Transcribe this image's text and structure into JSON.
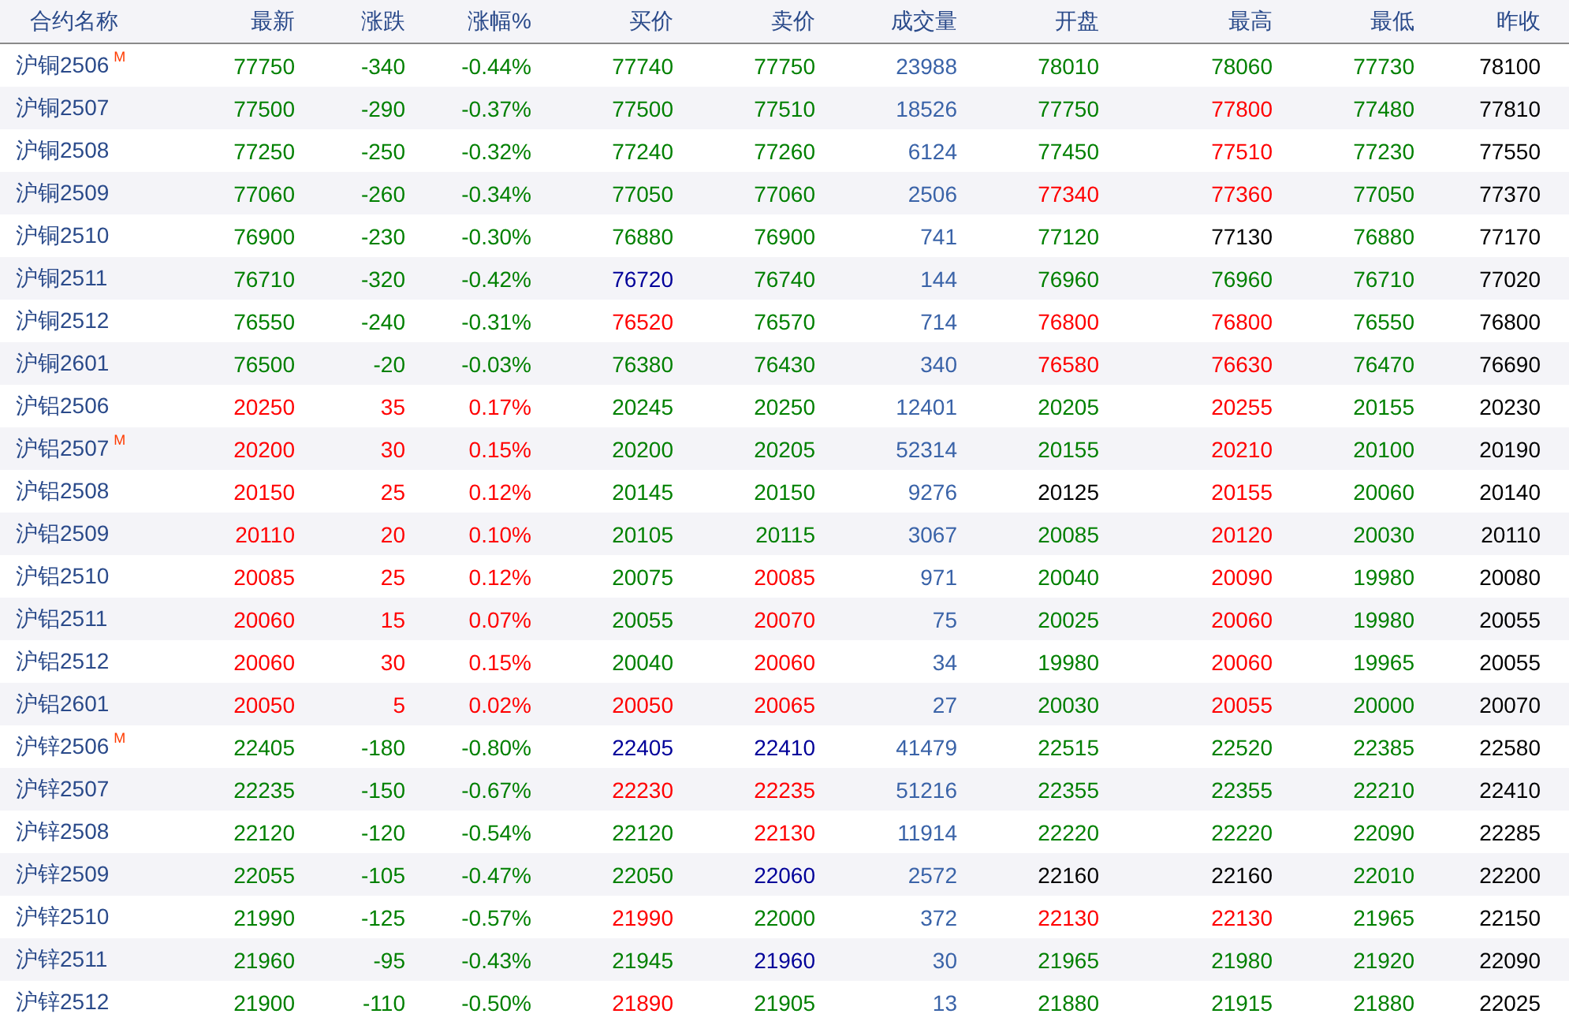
{
  "table": {
    "columns": [
      "合约名称",
      "最新",
      "涨跌",
      "涨幅%",
      "买价",
      "卖价",
      "成交量",
      "开盘",
      "最高",
      "最低",
      "昨收"
    ],
    "rows": [
      {
        "cells": [
          {
            "text": "沪铜2506",
            "badge": "M"
          },
          {
            "text": "77750",
            "color": "#008000"
          },
          {
            "text": "-340",
            "color": "#008000"
          },
          {
            "text": "-0.44%",
            "color": "#008000"
          },
          {
            "text": "77740",
            "color": "#008000"
          },
          {
            "text": "77750",
            "color": "#008000"
          },
          {
            "text": "23988",
            "color": "#3a63a8"
          },
          {
            "text": "78010",
            "color": "#008000"
          },
          {
            "text": "78060",
            "color": "#008000"
          },
          {
            "text": "77730",
            "color": "#008000"
          },
          {
            "text": "78100",
            "color": "#000000"
          }
        ]
      },
      {
        "cells": [
          {
            "text": "沪铜2507"
          },
          {
            "text": "77500",
            "color": "#008000"
          },
          {
            "text": "-290",
            "color": "#008000"
          },
          {
            "text": "-0.37%",
            "color": "#008000"
          },
          {
            "text": "77500",
            "color": "#008000"
          },
          {
            "text": "77510",
            "color": "#008000"
          },
          {
            "text": "18526",
            "color": "#3a63a8"
          },
          {
            "text": "77750",
            "color": "#008000"
          },
          {
            "text": "77800",
            "color": "#ff0000"
          },
          {
            "text": "77480",
            "color": "#008000"
          },
          {
            "text": "77810",
            "color": "#000000"
          }
        ]
      },
      {
        "cells": [
          {
            "text": "沪铜2508"
          },
          {
            "text": "77250",
            "color": "#008000"
          },
          {
            "text": "-250",
            "color": "#008000"
          },
          {
            "text": "-0.32%",
            "color": "#008000"
          },
          {
            "text": "77240",
            "color": "#008000"
          },
          {
            "text": "77260",
            "color": "#008000"
          },
          {
            "text": "6124",
            "color": "#3a63a8"
          },
          {
            "text": "77450",
            "color": "#008000"
          },
          {
            "text": "77510",
            "color": "#ff0000"
          },
          {
            "text": "77230",
            "color": "#008000"
          },
          {
            "text": "77550",
            "color": "#000000"
          }
        ]
      },
      {
        "cells": [
          {
            "text": "沪铜2509"
          },
          {
            "text": "77060",
            "color": "#008000"
          },
          {
            "text": "-260",
            "color": "#008000"
          },
          {
            "text": "-0.34%",
            "color": "#008000"
          },
          {
            "text": "77050",
            "color": "#008000"
          },
          {
            "text": "77060",
            "color": "#008000"
          },
          {
            "text": "2506",
            "color": "#3a63a8"
          },
          {
            "text": "77340",
            "color": "#ff0000"
          },
          {
            "text": "77360",
            "color": "#ff0000"
          },
          {
            "text": "77050",
            "color": "#008000"
          },
          {
            "text": "77370",
            "color": "#000000"
          }
        ]
      },
      {
        "cells": [
          {
            "text": "沪铜2510"
          },
          {
            "text": "76900",
            "color": "#008000"
          },
          {
            "text": "-230",
            "color": "#008000"
          },
          {
            "text": "-0.30%",
            "color": "#008000"
          },
          {
            "text": "76880",
            "color": "#008000"
          },
          {
            "text": "76900",
            "color": "#008000"
          },
          {
            "text": "741",
            "color": "#3a63a8"
          },
          {
            "text": "77120",
            "color": "#008000"
          },
          {
            "text": "77130",
            "color": "#000000"
          },
          {
            "text": "76880",
            "color": "#008000"
          },
          {
            "text": "77170",
            "color": "#000000"
          }
        ]
      },
      {
        "cells": [
          {
            "text": "沪铜2511"
          },
          {
            "text": "76710",
            "color": "#008000"
          },
          {
            "text": "-320",
            "color": "#008000"
          },
          {
            "text": "-0.42%",
            "color": "#008000"
          },
          {
            "text": "76720",
            "color": "#000099"
          },
          {
            "text": "76740",
            "color": "#008000"
          },
          {
            "text": "144",
            "color": "#3a63a8"
          },
          {
            "text": "76960",
            "color": "#008000"
          },
          {
            "text": "76960",
            "color": "#008000"
          },
          {
            "text": "76710",
            "color": "#008000"
          },
          {
            "text": "77020",
            "color": "#000000"
          }
        ]
      },
      {
        "cells": [
          {
            "text": "沪铜2512"
          },
          {
            "text": "76550",
            "color": "#008000"
          },
          {
            "text": "-240",
            "color": "#008000"
          },
          {
            "text": "-0.31%",
            "color": "#008000"
          },
          {
            "text": "76520",
            "color": "#ff0000"
          },
          {
            "text": "76570",
            "color": "#008000"
          },
          {
            "text": "714",
            "color": "#3a63a8"
          },
          {
            "text": "76800",
            "color": "#ff0000"
          },
          {
            "text": "76800",
            "color": "#ff0000"
          },
          {
            "text": "76550",
            "color": "#008000"
          },
          {
            "text": "76800",
            "color": "#000000"
          }
        ]
      },
      {
        "cells": [
          {
            "text": "沪铜2601"
          },
          {
            "text": "76500",
            "color": "#008000"
          },
          {
            "text": "-20",
            "color": "#008000"
          },
          {
            "text": "-0.03%",
            "color": "#008000"
          },
          {
            "text": "76380",
            "color": "#008000"
          },
          {
            "text": "76430",
            "color": "#008000"
          },
          {
            "text": "340",
            "color": "#3a63a8"
          },
          {
            "text": "76580",
            "color": "#ff0000"
          },
          {
            "text": "76630",
            "color": "#ff0000"
          },
          {
            "text": "76470",
            "color": "#008000"
          },
          {
            "text": "76690",
            "color": "#000000"
          }
        ]
      },
      {
        "cells": [
          {
            "text": "沪铝2506"
          },
          {
            "text": "20250",
            "color": "#ff0000"
          },
          {
            "text": "35",
            "color": "#ff0000"
          },
          {
            "text": "0.17%",
            "color": "#ff0000"
          },
          {
            "text": "20245",
            "color": "#008000"
          },
          {
            "text": "20250",
            "color": "#008000"
          },
          {
            "text": "12401",
            "color": "#3a63a8"
          },
          {
            "text": "20205",
            "color": "#008000"
          },
          {
            "text": "20255",
            "color": "#ff0000"
          },
          {
            "text": "20155",
            "color": "#008000"
          },
          {
            "text": "20230",
            "color": "#000000"
          }
        ]
      },
      {
        "cells": [
          {
            "text": "沪铝2507",
            "badge": "M"
          },
          {
            "text": "20200",
            "color": "#ff0000"
          },
          {
            "text": "30",
            "color": "#ff0000"
          },
          {
            "text": "0.15%",
            "color": "#ff0000"
          },
          {
            "text": "20200",
            "color": "#008000"
          },
          {
            "text": "20205",
            "color": "#008000"
          },
          {
            "text": "52314",
            "color": "#3a63a8"
          },
          {
            "text": "20155",
            "color": "#008000"
          },
          {
            "text": "20210",
            "color": "#ff0000"
          },
          {
            "text": "20100",
            "color": "#008000"
          },
          {
            "text": "20190",
            "color": "#000000"
          }
        ]
      },
      {
        "cells": [
          {
            "text": "沪铝2508"
          },
          {
            "text": "20150",
            "color": "#ff0000"
          },
          {
            "text": "25",
            "color": "#ff0000"
          },
          {
            "text": "0.12%",
            "color": "#ff0000"
          },
          {
            "text": "20145",
            "color": "#008000"
          },
          {
            "text": "20150",
            "color": "#008000"
          },
          {
            "text": "9276",
            "color": "#3a63a8"
          },
          {
            "text": "20125",
            "color": "#000000"
          },
          {
            "text": "20155",
            "color": "#ff0000"
          },
          {
            "text": "20060",
            "color": "#008000"
          },
          {
            "text": "20140",
            "color": "#000000"
          }
        ]
      },
      {
        "cells": [
          {
            "text": "沪铝2509"
          },
          {
            "text": "20110",
            "color": "#ff0000"
          },
          {
            "text": "20",
            "color": "#ff0000"
          },
          {
            "text": "0.10%",
            "color": "#ff0000"
          },
          {
            "text": "20105",
            "color": "#008000"
          },
          {
            "text": "20115",
            "color": "#008000"
          },
          {
            "text": "3067",
            "color": "#3a63a8"
          },
          {
            "text": "20085",
            "color": "#008000"
          },
          {
            "text": "20120",
            "color": "#ff0000"
          },
          {
            "text": "20030",
            "color": "#008000"
          },
          {
            "text": "20110",
            "color": "#000000"
          }
        ]
      },
      {
        "cells": [
          {
            "text": "沪铝2510"
          },
          {
            "text": "20085",
            "color": "#ff0000"
          },
          {
            "text": "25",
            "color": "#ff0000"
          },
          {
            "text": "0.12%",
            "color": "#ff0000"
          },
          {
            "text": "20075",
            "color": "#008000"
          },
          {
            "text": "20085",
            "color": "#ff0000"
          },
          {
            "text": "971",
            "color": "#3a63a8"
          },
          {
            "text": "20040",
            "color": "#008000"
          },
          {
            "text": "20090",
            "color": "#ff0000"
          },
          {
            "text": "19980",
            "color": "#008000"
          },
          {
            "text": "20080",
            "color": "#000000"
          }
        ]
      },
      {
        "cells": [
          {
            "text": "沪铝2511"
          },
          {
            "text": "20060",
            "color": "#ff0000"
          },
          {
            "text": "15",
            "color": "#ff0000"
          },
          {
            "text": "0.07%",
            "color": "#ff0000"
          },
          {
            "text": "20055",
            "color": "#008000"
          },
          {
            "text": "20070",
            "color": "#ff0000"
          },
          {
            "text": "75",
            "color": "#3a63a8"
          },
          {
            "text": "20025",
            "color": "#008000"
          },
          {
            "text": "20060",
            "color": "#ff0000"
          },
          {
            "text": "19980",
            "color": "#008000"
          },
          {
            "text": "20055",
            "color": "#000000"
          }
        ]
      },
      {
        "cells": [
          {
            "text": "沪铝2512"
          },
          {
            "text": "20060",
            "color": "#ff0000"
          },
          {
            "text": "30",
            "color": "#ff0000"
          },
          {
            "text": "0.15%",
            "color": "#ff0000"
          },
          {
            "text": "20040",
            "color": "#008000"
          },
          {
            "text": "20060",
            "color": "#ff0000"
          },
          {
            "text": "34",
            "color": "#3a63a8"
          },
          {
            "text": "19980",
            "color": "#008000"
          },
          {
            "text": "20060",
            "color": "#ff0000"
          },
          {
            "text": "19965",
            "color": "#008000"
          },
          {
            "text": "20055",
            "color": "#000000"
          }
        ]
      },
      {
        "cells": [
          {
            "text": "沪铝2601"
          },
          {
            "text": "20050",
            "color": "#ff0000"
          },
          {
            "text": "5",
            "color": "#ff0000"
          },
          {
            "text": "0.02%",
            "color": "#ff0000"
          },
          {
            "text": "20050",
            "color": "#ff0000"
          },
          {
            "text": "20065",
            "color": "#ff0000"
          },
          {
            "text": "27",
            "color": "#3a63a8"
          },
          {
            "text": "20030",
            "color": "#008000"
          },
          {
            "text": "20055",
            "color": "#ff0000"
          },
          {
            "text": "20000",
            "color": "#008000"
          },
          {
            "text": "20070",
            "color": "#000000"
          }
        ]
      },
      {
        "cells": [
          {
            "text": "沪锌2506",
            "badge": "M"
          },
          {
            "text": "22405",
            "color": "#008000"
          },
          {
            "text": "-180",
            "color": "#008000"
          },
          {
            "text": "-0.80%",
            "color": "#008000"
          },
          {
            "text": "22405",
            "color": "#000099"
          },
          {
            "text": "22410",
            "color": "#000099"
          },
          {
            "text": "41479",
            "color": "#3a63a8"
          },
          {
            "text": "22515",
            "color": "#008000"
          },
          {
            "text": "22520",
            "color": "#008000"
          },
          {
            "text": "22385",
            "color": "#008000"
          },
          {
            "text": "22580",
            "color": "#000000"
          }
        ]
      },
      {
        "cells": [
          {
            "text": "沪锌2507"
          },
          {
            "text": "22235",
            "color": "#008000"
          },
          {
            "text": "-150",
            "color": "#008000"
          },
          {
            "text": "-0.67%",
            "color": "#008000"
          },
          {
            "text": "22230",
            "color": "#ff0000"
          },
          {
            "text": "22235",
            "color": "#ff0000"
          },
          {
            "text": "51216",
            "color": "#3a63a8"
          },
          {
            "text": "22355",
            "color": "#008000"
          },
          {
            "text": "22355",
            "color": "#008000"
          },
          {
            "text": "22210",
            "color": "#008000"
          },
          {
            "text": "22410",
            "color": "#000000"
          }
        ]
      },
      {
        "cells": [
          {
            "text": "沪锌2508"
          },
          {
            "text": "22120",
            "color": "#008000"
          },
          {
            "text": "-120",
            "color": "#008000"
          },
          {
            "text": "-0.54%",
            "color": "#008000"
          },
          {
            "text": "22120",
            "color": "#008000"
          },
          {
            "text": "22130",
            "color": "#ff0000"
          },
          {
            "text": "11914",
            "color": "#3a63a8"
          },
          {
            "text": "22220",
            "color": "#008000"
          },
          {
            "text": "22220",
            "color": "#008000"
          },
          {
            "text": "22090",
            "color": "#008000"
          },
          {
            "text": "22285",
            "color": "#000000"
          }
        ]
      },
      {
        "cells": [
          {
            "text": "沪锌2509"
          },
          {
            "text": "22055",
            "color": "#008000"
          },
          {
            "text": "-105",
            "color": "#008000"
          },
          {
            "text": "-0.47%",
            "color": "#008000"
          },
          {
            "text": "22050",
            "color": "#008000"
          },
          {
            "text": "22060",
            "color": "#000099"
          },
          {
            "text": "2572",
            "color": "#3a63a8"
          },
          {
            "text": "22160",
            "color": "#000000"
          },
          {
            "text": "22160",
            "color": "#000000"
          },
          {
            "text": "22010",
            "color": "#008000"
          },
          {
            "text": "22200",
            "color": "#000000"
          }
        ]
      },
      {
        "cells": [
          {
            "text": "沪锌2510"
          },
          {
            "text": "21990",
            "color": "#008000"
          },
          {
            "text": "-125",
            "color": "#008000"
          },
          {
            "text": "-0.57%",
            "color": "#008000"
          },
          {
            "text": "21990",
            "color": "#ff0000"
          },
          {
            "text": "22000",
            "color": "#008000"
          },
          {
            "text": "372",
            "color": "#3a63a8"
          },
          {
            "text": "22130",
            "color": "#ff0000"
          },
          {
            "text": "22130",
            "color": "#ff0000"
          },
          {
            "text": "21965",
            "color": "#008000"
          },
          {
            "text": "22150",
            "color": "#000000"
          }
        ]
      },
      {
        "cells": [
          {
            "text": "沪锌2511"
          },
          {
            "text": "21960",
            "color": "#008000"
          },
          {
            "text": "-95",
            "color": "#008000"
          },
          {
            "text": "-0.43%",
            "color": "#008000"
          },
          {
            "text": "21945",
            "color": "#008000"
          },
          {
            "text": "21960",
            "color": "#000099"
          },
          {
            "text": "30",
            "color": "#3a63a8"
          },
          {
            "text": "21965",
            "color": "#008000"
          },
          {
            "text": "21980",
            "color": "#008000"
          },
          {
            "text": "21920",
            "color": "#008000"
          },
          {
            "text": "22090",
            "color": "#000000"
          }
        ]
      },
      {
        "cells": [
          {
            "text": "沪锌2512"
          },
          {
            "text": "21900",
            "color": "#008000"
          },
          {
            "text": "-110",
            "color": "#008000"
          },
          {
            "text": "-0.50%",
            "color": "#008000"
          },
          {
            "text": "21890",
            "color": "#ff0000"
          },
          {
            "text": "21905",
            "color": "#008000"
          },
          {
            "text": "13",
            "color": "#3a63a8"
          },
          {
            "text": "21880",
            "color": "#008000"
          },
          {
            "text": "21915",
            "color": "#008000"
          },
          {
            "text": "21880",
            "color": "#008000"
          },
          {
            "text": "22025",
            "color": "#000000"
          }
        ]
      }
    ]
  }
}
